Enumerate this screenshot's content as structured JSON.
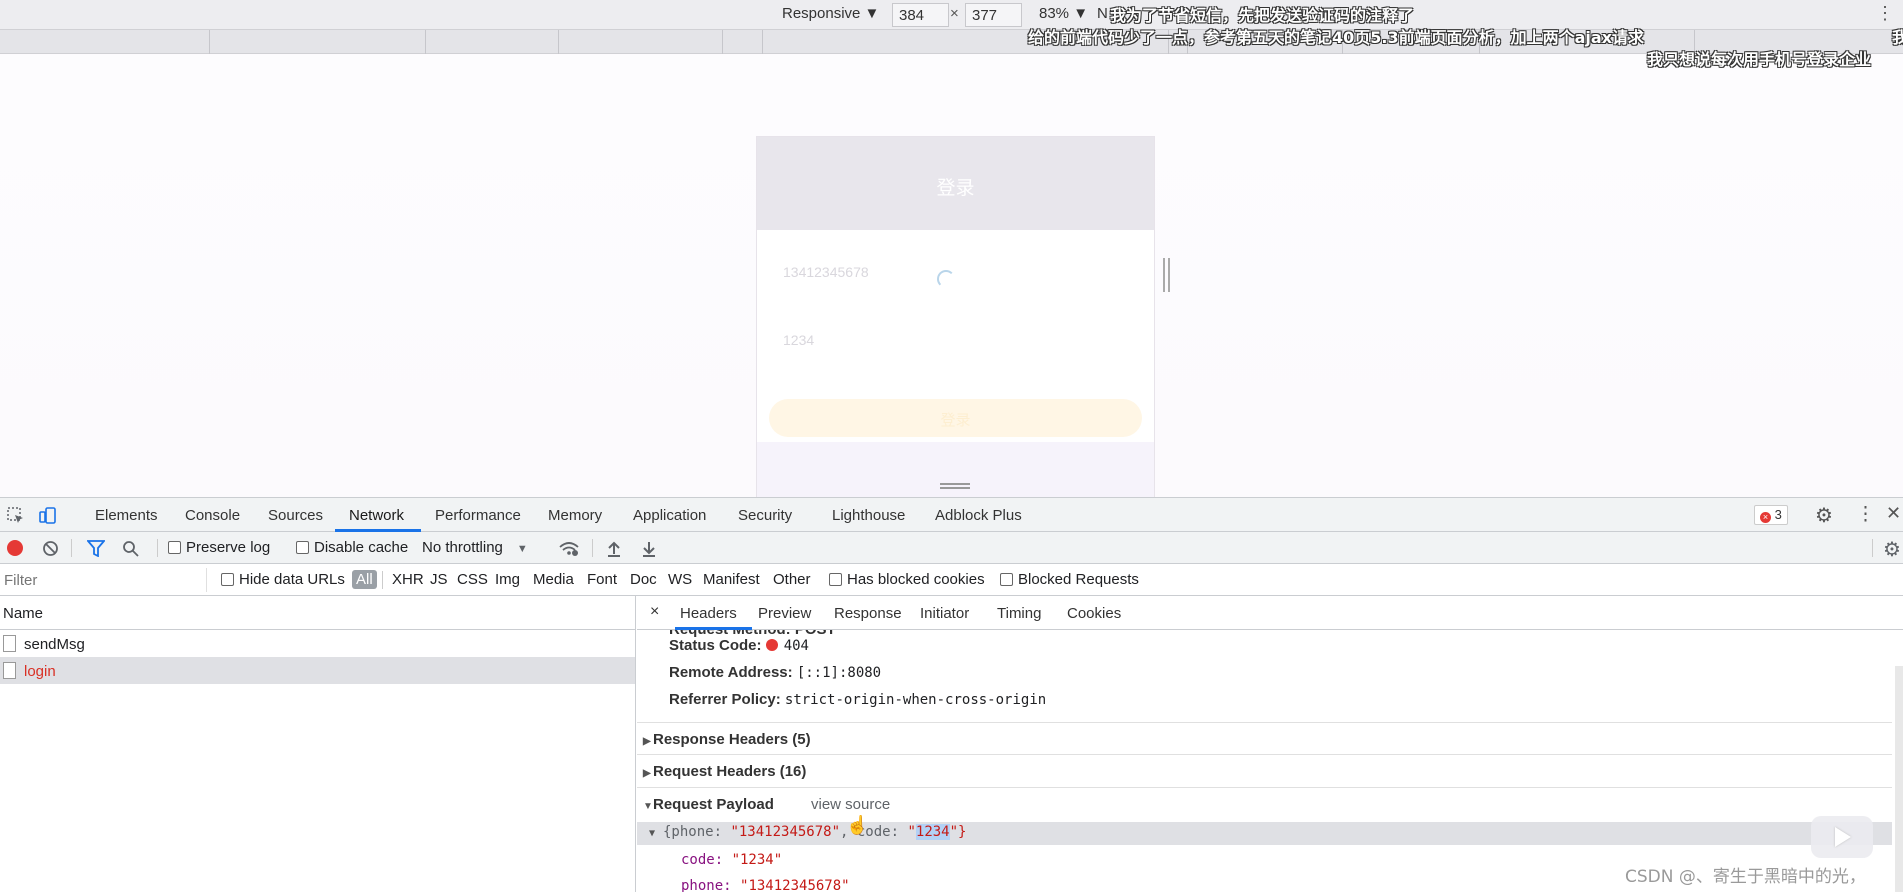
{
  "device_toolbar": {
    "preset": "Responsive ▼",
    "width": "384",
    "times": "×",
    "height": "377",
    "zoom": "83% ▼",
    "throttle_short": "N"
  },
  "danmaku": [
    "我为了节省短信，先把发送验证码的注释了",
    "给的前端代码少了一点，参考第五天的笔记40页5.3前端页面分析，加上两个ajax请求",
    "我只想说每次用手机号登录企业",
    "我"
  ],
  "phone_page": {
    "title": "登录",
    "phone_value": "13412345678",
    "code_value": "1234",
    "login_button": "登录"
  },
  "devtools": {
    "tabs": [
      "Elements",
      "Console",
      "Sources",
      "Network",
      "Performance",
      "Memory",
      "Application",
      "Security",
      "Lighthouse",
      "Adblock Plus"
    ],
    "active_tab": "Network",
    "error_count": "3",
    "error_symbol": "×"
  },
  "network_toolbar": {
    "preserve_log": "Preserve log",
    "disable_cache": "Disable cache",
    "throttling": "No throttling"
  },
  "filter_bar": {
    "placeholder": "Filter",
    "hide_data_urls": "Hide data URLs",
    "types": [
      "All",
      "XHR",
      "JS",
      "CSS",
      "Img",
      "Media",
      "Font",
      "Doc",
      "WS",
      "Manifest",
      "Other"
    ],
    "has_blocked_cookies": "Has blocked cookies",
    "blocked_requests": "Blocked Requests"
  },
  "requests": {
    "column_name": "Name",
    "rows": [
      "sendMsg",
      "login"
    ]
  },
  "detail": {
    "close": "×",
    "tabs": [
      "Headers",
      "Preview",
      "Response",
      "Initiator",
      "Timing",
      "Cookies"
    ],
    "cut_line": "Request Method: POST",
    "status_label": "Status Code:",
    "status_value": "404",
    "remote_label": "Remote Address:",
    "remote_value": "[::1]:8080",
    "referrer_label": "Referrer Policy:",
    "referrer_value": "strict-origin-when-cross-origin",
    "response_headers": "Response Headers (5)",
    "request_headers": "Request Headers (16)",
    "request_payload": "Request Payload",
    "view_source": "view source",
    "payload_summary_pre": "{phone: ",
    "payload_phone": "\"13412345678\"",
    "payload_mid": ", code: ",
    "payload_code_q": "\"",
    "payload_code": "1234",
    "payload_end": "\"}",
    "code_key": "code: ",
    "code_val": "\"1234\"",
    "phone_key": "phone: ",
    "phone_val": "\"13412345678\""
  },
  "watermark": "CSDN @、寄生于黑暗中的光，"
}
